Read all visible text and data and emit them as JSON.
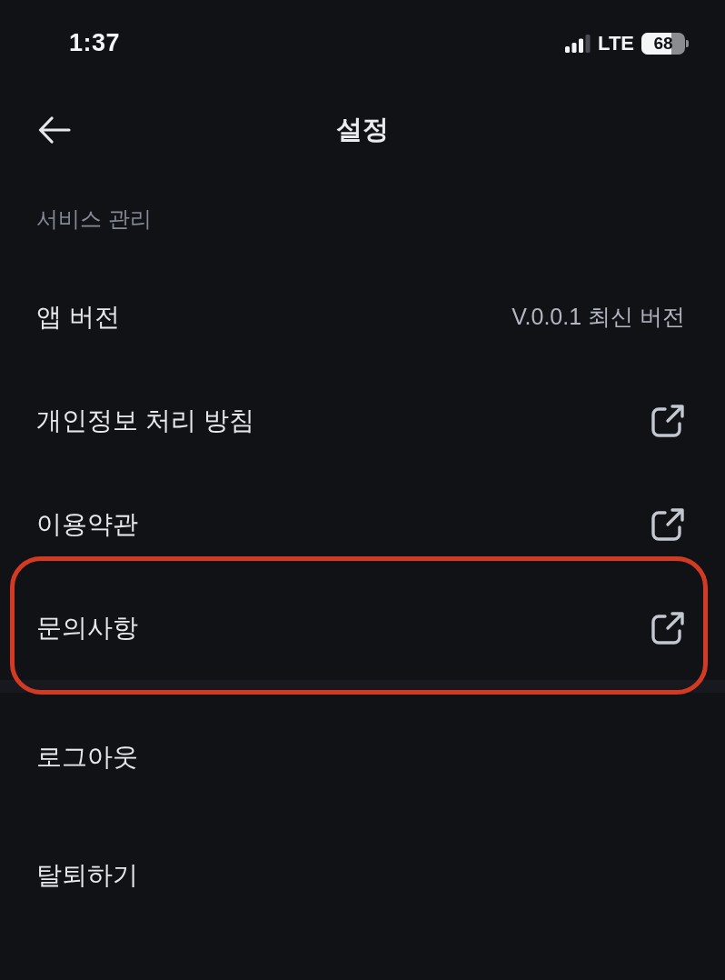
{
  "status_bar": {
    "time": "1:37",
    "network": "LTE",
    "battery": {
      "reading": "68",
      "level": 0.68
    }
  },
  "header": {
    "title": "설정"
  },
  "sections": [
    {
      "title": "서비스 관리",
      "items": [
        {
          "label": "앱 버전",
          "kind": "value",
          "value": "V.0.0.1 최신 버전",
          "highlighted": false
        },
        {
          "label": "개인정보 처리 방침",
          "kind": "link",
          "highlighted": false
        },
        {
          "label": "이용약관",
          "kind": "link",
          "highlighted": false
        },
        {
          "label": "문의사항",
          "kind": "link",
          "highlighted": true
        }
      ]
    },
    {
      "items": [
        {
          "label": "로그아웃",
          "kind": "plain",
          "highlighted": false
        },
        {
          "label": "탈퇴하기",
          "kind": "plain",
          "highlighted": false
        }
      ]
    }
  ]
}
